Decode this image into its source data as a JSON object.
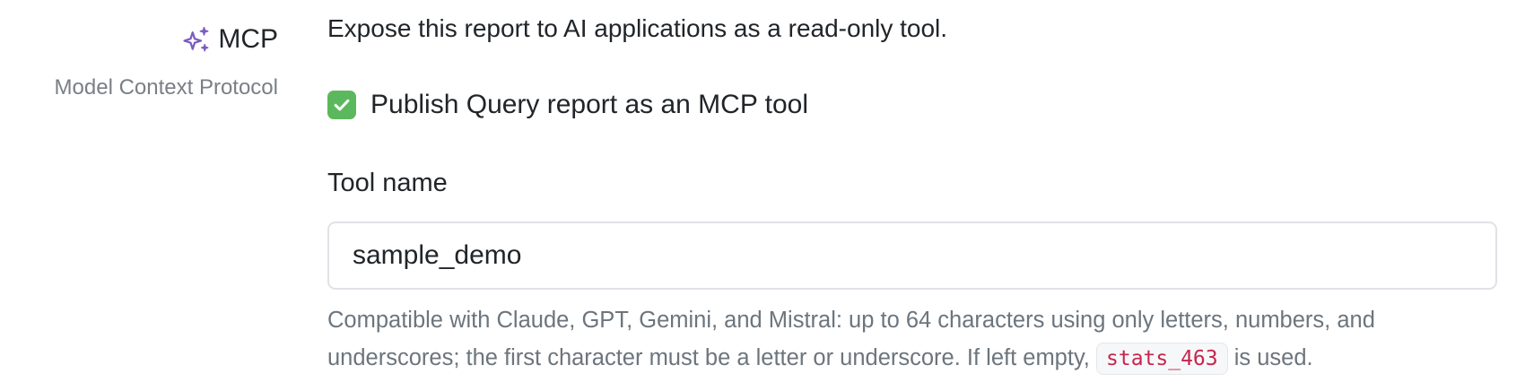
{
  "section": {
    "title": "MCP",
    "subtitle": "Model Context Protocol",
    "icon": "sparkles-icon",
    "icon_color": "#7b5cc5"
  },
  "description": "Expose this report to AI applications as a read-only tool.",
  "publish_checkbox": {
    "label": "Publish Query report as an MCP tool",
    "checked": true,
    "color": "#5cb85c"
  },
  "tool_name": {
    "label": "Tool name",
    "value": "sample_demo"
  },
  "help": {
    "text_before": "Compatible with Claude, GPT, Gemini, and Mistral: up to 64 characters using only letters, numbers, and underscores; the first character must be a letter or underscore. If left empty,",
    "default_name": "stats_463",
    "text_after": "is used."
  }
}
